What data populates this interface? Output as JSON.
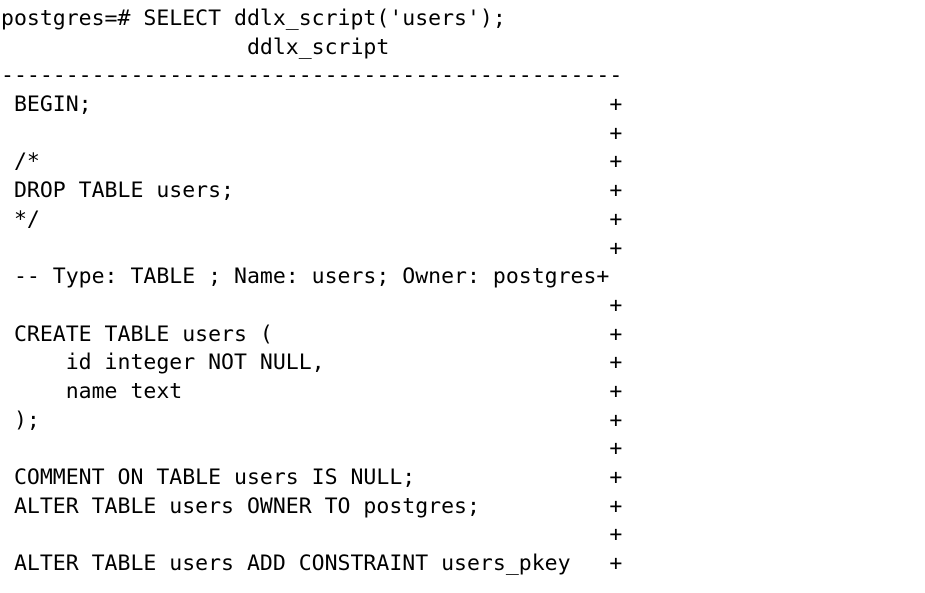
{
  "terminal": {
    "app": "psql",
    "background_color": "#ffffff",
    "foreground_color": "#000000",
    "prompt": "postgres=#",
    "command": "SELECT ddlx_script('users');",
    "prompt_line": "postgres=# SELECT ddlx_script('users');",
    "result_column_header": "ddlx_script",
    "header_line": "                   ddlx_script",
    "separator_line": "------------------------------------------------",
    "continuation_marker": "+",
    "lines": [
      "postgres=# SELECT ddlx_script('users');",
      "                   ddlx_script",
      "------------------------------------------------",
      " BEGIN;                                        +",
      "                                               +",
      " /*                                            +",
      " DROP TABLE users;                             +",
      " */                                            +",
      "                                               +",
      " -- Type: TABLE ; Name: users; Owner: postgres+",
      "                                               +",
      " CREATE TABLE users (                          +",
      "     id integer NOT NULL,                      +",
      "     name text                                 +",
      " );                                            +",
      "                                               +",
      " COMMENT ON TABLE users IS NULL;               +",
      " ALTER TABLE users OWNER TO postgres;          +",
      "                                               +",
      " ALTER TABLE users ADD CONSTRAINT users_pkey   +"
    ],
    "statements": [
      "BEGIN;",
      "/*",
      "DROP TABLE users;",
      "*/",
      "-- Type: TABLE ; Name: users; Owner: postgres",
      "CREATE TABLE users (",
      "    id integer NOT NULL,",
      "    name text",
      ");",
      "COMMENT ON TABLE users IS NULL;",
      "ALTER TABLE users OWNER TO postgres;",
      "ALTER TABLE users ADD CONSTRAINT users_pkey"
    ]
  }
}
